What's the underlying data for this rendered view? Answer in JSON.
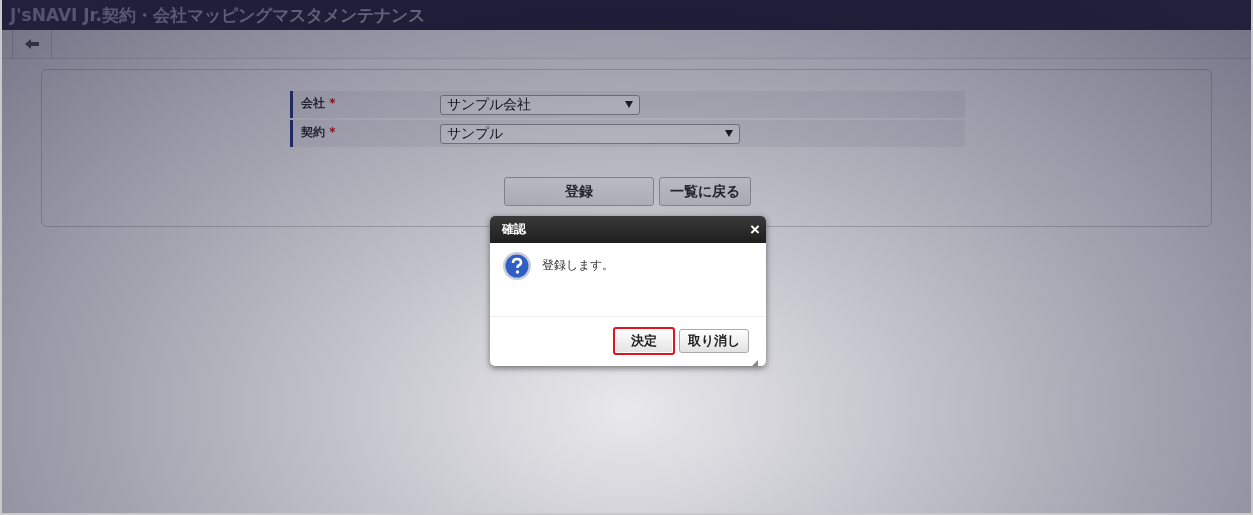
{
  "window": {
    "title": "J'sNAVI Jr.契約・会社マッピングマスタメンテナンス"
  },
  "form": {
    "fields": [
      {
        "label": "会社",
        "required_mark": "*",
        "value": "サンプル会社",
        "wide": false
      },
      {
        "label": "契約",
        "required_mark": "*",
        "value": "サンプル",
        "wide": true
      }
    ],
    "buttons": [
      {
        "label": "登録",
        "kind": "primary"
      },
      {
        "label": "一覧に戻る",
        "kind": "secondary"
      }
    ]
  },
  "dialog": {
    "title": "確認",
    "close": "×",
    "message": "登録します。",
    "buttons": [
      {
        "label": "決定",
        "highlighted": true
      },
      {
        "label": "取り消し",
        "highlighted": false
      }
    ]
  }
}
